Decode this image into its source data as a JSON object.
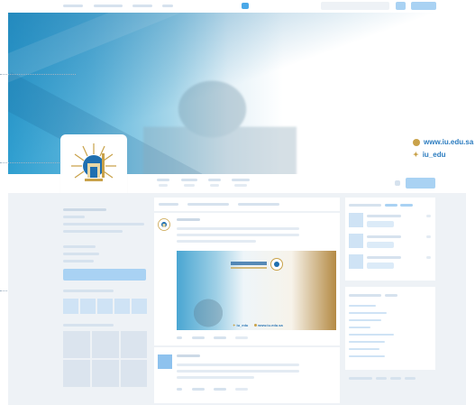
{
  "banner": {
    "website": "www.iu.edu.sa",
    "twitter_handle": "iu_edu"
  },
  "post": {
    "image_twitter": "iu_edu",
    "image_website": "www.iu.edu.sa"
  },
  "colors": {
    "accent": "#a9d2f3",
    "banner_blue": "#2f9fd0",
    "link": "#2a7bbf",
    "gold": "#c9a24a",
    "background": "#eef2f6"
  },
  "icons": [
    "globe-icon",
    "twitter-icon",
    "logo-icon"
  ]
}
